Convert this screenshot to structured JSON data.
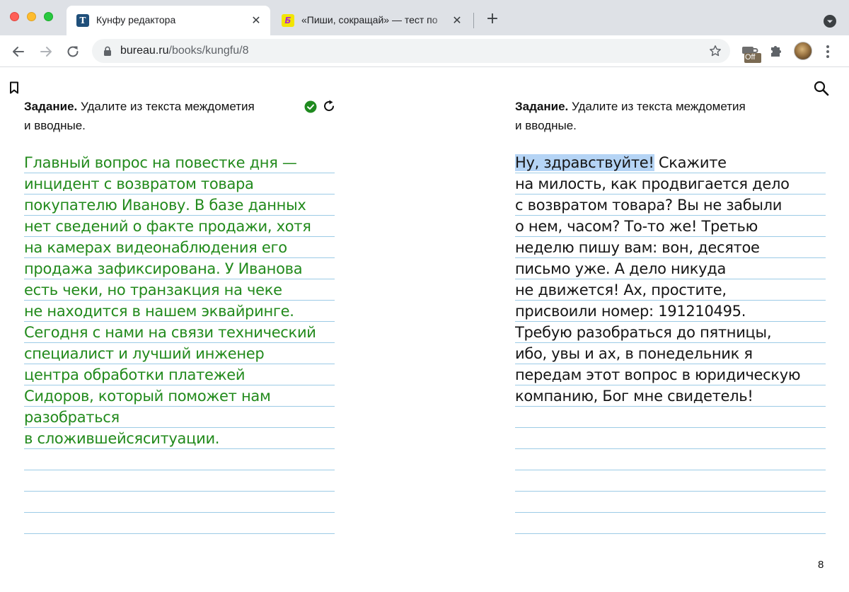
{
  "browser": {
    "tabs": [
      {
        "title": "Кунфу редактора",
        "favicon": "Т",
        "active": true
      },
      {
        "title": "«Пиши, сокращай» — тест по",
        "favicon": "Б",
        "active": false
      }
    ],
    "url_host": "bureau.ru",
    "url_path": "/books/kungfu/8",
    "extension_badge": "Off"
  },
  "page": {
    "left": {
      "task_label": "Задание.",
      "task_text": "Удалите из текста междометия",
      "task_text_2": "и вводные.",
      "status_icon": "check-circle-icon",
      "lines": [
        "Главный вопрос на повестке дня —",
        "инцидент с возвратом товара",
        "покупателю Иванову. В базе данных",
        "нет сведений о факте продажи, хотя",
        "на камерах видеонаблюдения его",
        "продажа зафиксирована. У Иванова",
        "есть чеки, но транзакция на чеке",
        "не находится в нашем эквайринге.",
        "Сегодня с нами на связи технический",
        "специалист и лучший инженер",
        "центра обработки платежей",
        "Сидоров, который поможет нам",
        "разобраться",
        "в сложившейсяситуации."
      ]
    },
    "right": {
      "task_label": "Задание.",
      "task_text": "Удалите из текста междометия",
      "task_text_2": "и вводные.",
      "first_highlight": "Ну, здравствуйте!",
      "first_rest": " Скажите",
      "lines": [
        "на милость, как продвигается дело",
        "с возвратом товара? Вы не забыли",
        "о нем, часом? То-то же! Третью",
        "неделю пишу вам: вон, десятое",
        "письмо уже. А дело никуда",
        "не движется! Ах, простите,",
        "присвоили номер: 191210495.",
        "Требую разобраться до пятницы,",
        "ибо, увы и ах, в понедельник я",
        "передам этот вопрос в юридическую",
        "компанию, Бог мне свидетель!"
      ]
    },
    "page_number": "8"
  },
  "colors": {
    "edited_text": "#228a1c",
    "rule_line": "#9ccbe6",
    "selection": "#b5d4f5"
  }
}
